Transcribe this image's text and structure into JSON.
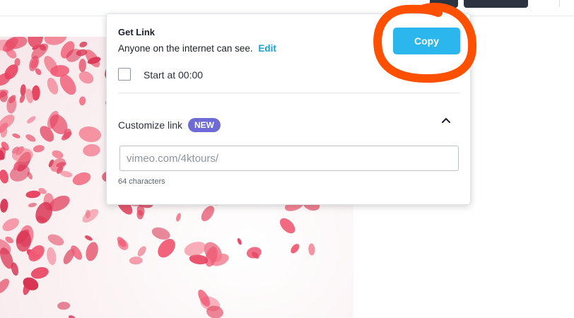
{
  "popover": {
    "title": "Get Link",
    "subtitle": "Anyone on the internet can see.",
    "edit_link": "Edit",
    "copy_button": "Copy",
    "start_at_label": "Start at 00:00",
    "start_at_checked": false,
    "customize_label": "Customize link",
    "new_badge": "NEW",
    "link_placeholder": "vimeo.com/4ktours/",
    "char_count": "64 characters"
  },
  "colors": {
    "copy_button": "#2bb6ee",
    "edit_link": "#1a9fd6",
    "new_badge": "#6f6bd6",
    "annotation": "#ff4f00",
    "petal": "#e8415e"
  },
  "icons": {
    "customize_toggle": "chevron-up-icon"
  }
}
